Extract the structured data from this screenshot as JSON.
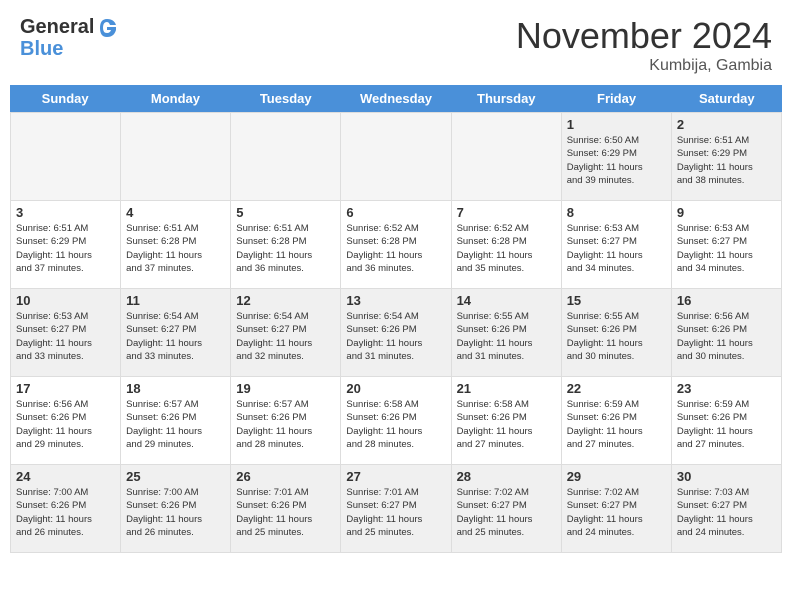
{
  "header": {
    "logo_line1": "General",
    "logo_line2": "Blue",
    "month": "November 2024",
    "location": "Kumbija, Gambia"
  },
  "weekdays": [
    "Sunday",
    "Monday",
    "Tuesday",
    "Wednesday",
    "Thursday",
    "Friday",
    "Saturday"
  ],
  "weeks": [
    [
      {
        "day": "",
        "info": "",
        "empty": true
      },
      {
        "day": "",
        "info": "",
        "empty": true
      },
      {
        "day": "",
        "info": "",
        "empty": true
      },
      {
        "day": "",
        "info": "",
        "empty": true
      },
      {
        "day": "",
        "info": "",
        "empty": true
      },
      {
        "day": "1",
        "info": "Sunrise: 6:50 AM\nSunset: 6:29 PM\nDaylight: 11 hours\nand 39 minutes.",
        "empty": false
      },
      {
        "day": "2",
        "info": "Sunrise: 6:51 AM\nSunset: 6:29 PM\nDaylight: 11 hours\nand 38 minutes.",
        "empty": false
      }
    ],
    [
      {
        "day": "3",
        "info": "Sunrise: 6:51 AM\nSunset: 6:29 PM\nDaylight: 11 hours\nand 37 minutes.",
        "empty": false
      },
      {
        "day": "4",
        "info": "Sunrise: 6:51 AM\nSunset: 6:28 PM\nDaylight: 11 hours\nand 37 minutes.",
        "empty": false
      },
      {
        "day": "5",
        "info": "Sunrise: 6:51 AM\nSunset: 6:28 PM\nDaylight: 11 hours\nand 36 minutes.",
        "empty": false
      },
      {
        "day": "6",
        "info": "Sunrise: 6:52 AM\nSunset: 6:28 PM\nDaylight: 11 hours\nand 36 minutes.",
        "empty": false
      },
      {
        "day": "7",
        "info": "Sunrise: 6:52 AM\nSunset: 6:28 PM\nDaylight: 11 hours\nand 35 minutes.",
        "empty": false
      },
      {
        "day": "8",
        "info": "Sunrise: 6:53 AM\nSunset: 6:27 PM\nDaylight: 11 hours\nand 34 minutes.",
        "empty": false
      },
      {
        "day": "9",
        "info": "Sunrise: 6:53 AM\nSunset: 6:27 PM\nDaylight: 11 hours\nand 34 minutes.",
        "empty": false
      }
    ],
    [
      {
        "day": "10",
        "info": "Sunrise: 6:53 AM\nSunset: 6:27 PM\nDaylight: 11 hours\nand 33 minutes.",
        "empty": false
      },
      {
        "day": "11",
        "info": "Sunrise: 6:54 AM\nSunset: 6:27 PM\nDaylight: 11 hours\nand 33 minutes.",
        "empty": false
      },
      {
        "day": "12",
        "info": "Sunrise: 6:54 AM\nSunset: 6:27 PM\nDaylight: 11 hours\nand 32 minutes.",
        "empty": false
      },
      {
        "day": "13",
        "info": "Sunrise: 6:54 AM\nSunset: 6:26 PM\nDaylight: 11 hours\nand 31 minutes.",
        "empty": false
      },
      {
        "day": "14",
        "info": "Sunrise: 6:55 AM\nSunset: 6:26 PM\nDaylight: 11 hours\nand 31 minutes.",
        "empty": false
      },
      {
        "day": "15",
        "info": "Sunrise: 6:55 AM\nSunset: 6:26 PM\nDaylight: 11 hours\nand 30 minutes.",
        "empty": false
      },
      {
        "day": "16",
        "info": "Sunrise: 6:56 AM\nSunset: 6:26 PM\nDaylight: 11 hours\nand 30 minutes.",
        "empty": false
      }
    ],
    [
      {
        "day": "17",
        "info": "Sunrise: 6:56 AM\nSunset: 6:26 PM\nDaylight: 11 hours\nand 29 minutes.",
        "empty": false
      },
      {
        "day": "18",
        "info": "Sunrise: 6:57 AM\nSunset: 6:26 PM\nDaylight: 11 hours\nand 29 minutes.",
        "empty": false
      },
      {
        "day": "19",
        "info": "Sunrise: 6:57 AM\nSunset: 6:26 PM\nDaylight: 11 hours\nand 28 minutes.",
        "empty": false
      },
      {
        "day": "20",
        "info": "Sunrise: 6:58 AM\nSunset: 6:26 PM\nDaylight: 11 hours\nand 28 minutes.",
        "empty": false
      },
      {
        "day": "21",
        "info": "Sunrise: 6:58 AM\nSunset: 6:26 PM\nDaylight: 11 hours\nand 27 minutes.",
        "empty": false
      },
      {
        "day": "22",
        "info": "Sunrise: 6:59 AM\nSunset: 6:26 PM\nDaylight: 11 hours\nand 27 minutes.",
        "empty": false
      },
      {
        "day": "23",
        "info": "Sunrise: 6:59 AM\nSunset: 6:26 PM\nDaylight: 11 hours\nand 27 minutes.",
        "empty": false
      }
    ],
    [
      {
        "day": "24",
        "info": "Sunrise: 7:00 AM\nSunset: 6:26 PM\nDaylight: 11 hours\nand 26 minutes.",
        "empty": false
      },
      {
        "day": "25",
        "info": "Sunrise: 7:00 AM\nSunset: 6:26 PM\nDaylight: 11 hours\nand 26 minutes.",
        "empty": false
      },
      {
        "day": "26",
        "info": "Sunrise: 7:01 AM\nSunset: 6:26 PM\nDaylight: 11 hours\nand 25 minutes.",
        "empty": false
      },
      {
        "day": "27",
        "info": "Sunrise: 7:01 AM\nSunset: 6:27 PM\nDaylight: 11 hours\nand 25 minutes.",
        "empty": false
      },
      {
        "day": "28",
        "info": "Sunrise: 7:02 AM\nSunset: 6:27 PM\nDaylight: 11 hours\nand 25 minutes.",
        "empty": false
      },
      {
        "day": "29",
        "info": "Sunrise: 7:02 AM\nSunset: 6:27 PM\nDaylight: 11 hours\nand 24 minutes.",
        "empty": false
      },
      {
        "day": "30",
        "info": "Sunrise: 7:03 AM\nSunset: 6:27 PM\nDaylight: 11 hours\nand 24 minutes.",
        "empty": false
      }
    ]
  ]
}
